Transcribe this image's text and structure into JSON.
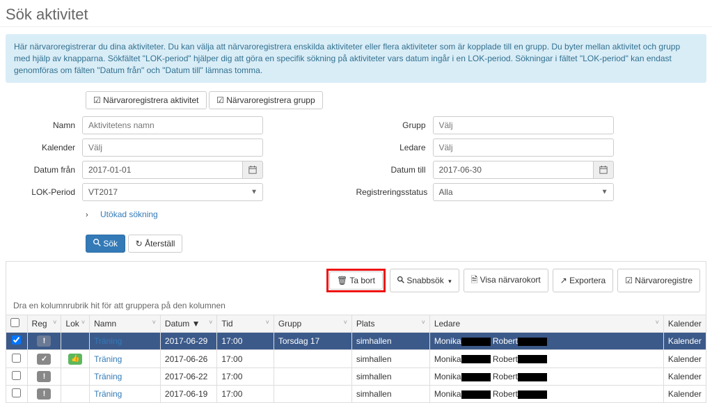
{
  "title": "Sök aktivitet",
  "info": "Här närvaroregistrerar du dina aktiviteter. Du kan välja att närvaroregistrera enskilda aktiviteter eller flera aktiviteter som är kopplade till en grupp. Du byter mellan aktivitet och grupp med hjälp av knapparna. Sökfältet \"LOK-period\" hjälper dig att göra en specifik sökning på aktiviteter vars datum ingår i en LOK-period. Sökningar i fältet \"LOK-period\" kan endast genomföras om fälten \"Datum från\" och \"Datum till\" lämnas tomma.",
  "buttons": {
    "reg_aktivitet": "Närvaroregistrera aktivitet",
    "reg_grupp": "Närvaroregistrera grupp",
    "sok": "Sök",
    "aterstall": "Återställ",
    "ta_bort": "Ta bort",
    "snabbsok": "Snabbsök",
    "visa_kort": "Visa närvarokort",
    "exportera": "Exportera",
    "narvaroreg": "Närvaroregistre"
  },
  "labels": {
    "namn": "Namn",
    "grupp": "Grupp",
    "kalender": "Kalender",
    "ledare": "Ledare",
    "datum_fran": "Datum från",
    "datum_till": "Datum till",
    "lok_period": "LOK-Period",
    "reg_status": "Registreringsstatus",
    "utokad": "Utökad sökning"
  },
  "placeholders": {
    "namn": "Aktivitetens namn",
    "valj": "Välj"
  },
  "values": {
    "datum_fran": "2017-01-01",
    "datum_till": "2017-06-30",
    "lok_period": "VT2017",
    "reg_status": "Alla"
  },
  "group_hint": "Dra en kolumnrubrik hit för att gruppera på den kolumnen",
  "columns": {
    "reg": "Reg",
    "lok": "Lok",
    "namn": "Namn",
    "datum": "Datum ▼",
    "tid": "Tid",
    "grupp": "Grupp",
    "plats": "Plats",
    "ledare": "Ledare",
    "kalender": "Kalender"
  },
  "rows": [
    {
      "selected": true,
      "reg": "!",
      "lok": "",
      "namn": "Träning",
      "datum": "2017-06-29",
      "tid": "17:00",
      "grupp": "Torsdag 17",
      "plats": "simhallen",
      "ledare1": "Monika",
      "ledare2": "Robert",
      "kalender": "Kalender"
    },
    {
      "selected": false,
      "reg": "✓",
      "lok": "up",
      "namn": "Träning",
      "datum": "2017-06-26",
      "tid": "17:00",
      "grupp": "",
      "plats": "simhallen",
      "ledare1": "Monika",
      "ledare2": "Robert",
      "kalender": "Kalender"
    },
    {
      "selected": false,
      "reg": "!",
      "lok": "",
      "namn": "Träning",
      "datum": "2017-06-22",
      "tid": "17:00",
      "grupp": "",
      "plats": "simhallen",
      "ledare1": "Monika",
      "ledare2": "Robert",
      "kalender": "Kalender"
    },
    {
      "selected": false,
      "reg": "!",
      "lok": "",
      "namn": "Träning",
      "datum": "2017-06-19",
      "tid": "17:00",
      "grupp": "",
      "plats": "simhallen",
      "ledare1": "Monika",
      "ledare2": "Robert",
      "kalender": "Kalender"
    }
  ]
}
